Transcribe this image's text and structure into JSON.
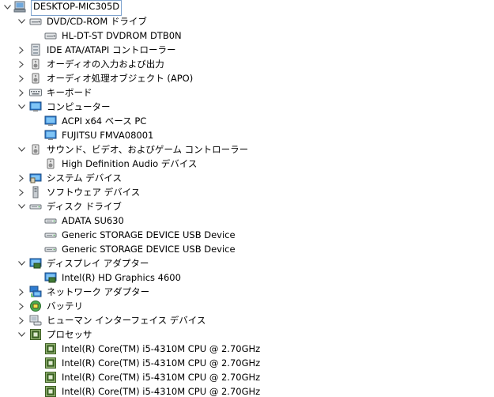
{
  "tree": [
    {
      "label": "DESKTOP-MIC305D",
      "level": 0,
      "expander": "expanded",
      "icon": "computer-root-icon"
    },
    {
      "label": "DVD/CD-ROM ドライブ",
      "level": 1,
      "expander": "expanded",
      "icon": "dvd-drive-icon"
    },
    {
      "label": "HL-DT-ST DVDROM DTB0N",
      "level": 2,
      "expander": "none",
      "icon": "dvd-drive-icon"
    },
    {
      "label": "IDE ATA/ATAPI コントローラー",
      "level": 1,
      "expander": "collapsed",
      "icon": "ide-controller-icon"
    },
    {
      "label": "オーディオの入力および出力",
      "level": 1,
      "expander": "collapsed",
      "icon": "speaker-icon"
    },
    {
      "label": "オーディオ処理オブジェクト (APO)",
      "level": 1,
      "expander": "collapsed",
      "icon": "speaker-icon"
    },
    {
      "label": "キーボード",
      "level": 1,
      "expander": "collapsed",
      "icon": "keyboard-icon"
    },
    {
      "label": "コンピューター",
      "level": 1,
      "expander": "expanded",
      "icon": "monitor-icon"
    },
    {
      "label": "ACPI x64 ベース PC",
      "level": 2,
      "expander": "none",
      "icon": "monitor-icon"
    },
    {
      "label": "FUJITSU FMVA08001",
      "level": 2,
      "expander": "none",
      "icon": "monitor-icon"
    },
    {
      "label": "サウンド、ビデオ、およびゲーム コントローラー",
      "level": 1,
      "expander": "expanded",
      "icon": "speaker-icon"
    },
    {
      "label": "High Definition Audio デバイス",
      "level": 2,
      "expander": "none",
      "icon": "speaker-icon"
    },
    {
      "label": "システム デバイス",
      "level": 1,
      "expander": "collapsed",
      "icon": "system-devices-icon"
    },
    {
      "label": "ソフトウェア デバイス",
      "level": 1,
      "expander": "collapsed",
      "icon": "software-device-icon"
    },
    {
      "label": "ディスク ドライブ",
      "level": 1,
      "expander": "expanded",
      "icon": "disk-drive-icon"
    },
    {
      "label": "ADATA SU630",
      "level": 2,
      "expander": "none",
      "icon": "disk-drive-icon"
    },
    {
      "label": "Generic STORAGE DEVICE USB Device",
      "level": 2,
      "expander": "none",
      "icon": "disk-drive-icon"
    },
    {
      "label": "Generic STORAGE DEVICE USB Device",
      "level": 2,
      "expander": "none",
      "icon": "disk-drive-icon"
    },
    {
      "label": "ディスプレイ アダプター",
      "level": 1,
      "expander": "expanded",
      "icon": "display-adapter-icon"
    },
    {
      "label": "Intel(R) HD Graphics 4600",
      "level": 2,
      "expander": "none",
      "icon": "display-adapter-icon"
    },
    {
      "label": "ネットワーク アダプター",
      "level": 1,
      "expander": "collapsed",
      "icon": "network-adapter-icon"
    },
    {
      "label": "バッテリ",
      "level": 1,
      "expander": "collapsed",
      "icon": "battery-icon"
    },
    {
      "label": "ヒューマン インターフェイス デバイス",
      "level": 1,
      "expander": "collapsed",
      "icon": "hid-icon"
    },
    {
      "label": "プロセッサ",
      "level": 1,
      "expander": "expanded",
      "icon": "processor-icon"
    },
    {
      "label": "Intel(R) Core(TM) i5-4310M CPU @ 2.70GHz",
      "level": 2,
      "expander": "none",
      "icon": "processor-icon"
    },
    {
      "label": "Intel(R) Core(TM) i5-4310M CPU @ 2.70GHz",
      "level": 2,
      "expander": "none",
      "icon": "processor-icon"
    },
    {
      "label": "Intel(R) Core(TM) i5-4310M CPU @ 2.70GHz",
      "level": 2,
      "expander": "none",
      "icon": "processor-icon"
    },
    {
      "label": "Intel(R) Core(TM) i5-4310M CPU @ 2.70GHz",
      "level": 2,
      "expander": "none",
      "icon": "processor-icon"
    }
  ],
  "colors": {
    "selection_border": "#7da2ce",
    "expander": "#404040",
    "processor_green": "#4a7a2a",
    "monitor_blue": "#2e7bcf"
  }
}
